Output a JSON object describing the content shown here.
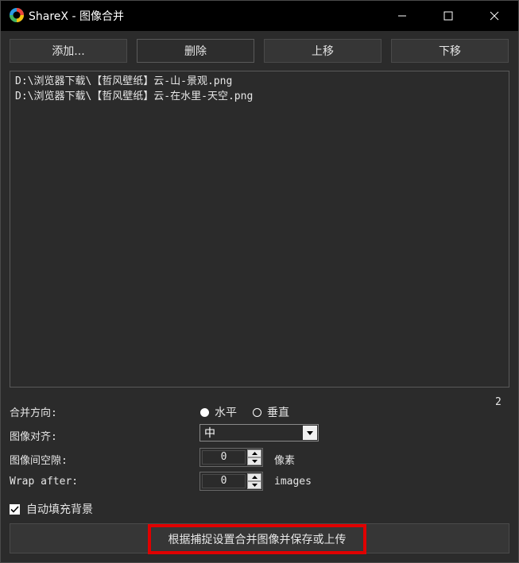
{
  "window": {
    "title": "ShareX - 图像合并",
    "controls": {
      "minimize_icon": "minimize-icon",
      "maximize_icon": "maximize-icon",
      "close_icon": "close-icon"
    }
  },
  "toolbar": {
    "add_label": "添加...",
    "delete_label": "删除",
    "move_up_label": "上移",
    "move_down_label": "下移"
  },
  "file_list": {
    "items": [
      "D:\\浏览器下载\\【哲风壁纸】云-山-景观.png",
      "D:\\浏览器下载\\【哲风壁纸】云-在水里-天空.png"
    ],
    "count": "2"
  },
  "options": {
    "orientation_label": "合并方向:",
    "orientation_options": [
      "水平",
      "垂直"
    ],
    "orientation_selected": "水平",
    "alignment_label": "图像对齐:",
    "alignment_value": "中",
    "spacing_label": "图像间空隙:",
    "spacing_value": "0",
    "spacing_unit": "像素",
    "wrap_label": "Wrap after:",
    "wrap_value": "0",
    "wrap_unit": "images",
    "auto_fill_label": "自动填充背景",
    "auto_fill_checked": true
  },
  "action": {
    "combine_label": "根据捕捉设置合并图像并保存或上传"
  },
  "colors": {
    "background": "#2b2b2b",
    "titlebar": "#000000",
    "highlight": "#e00000"
  }
}
